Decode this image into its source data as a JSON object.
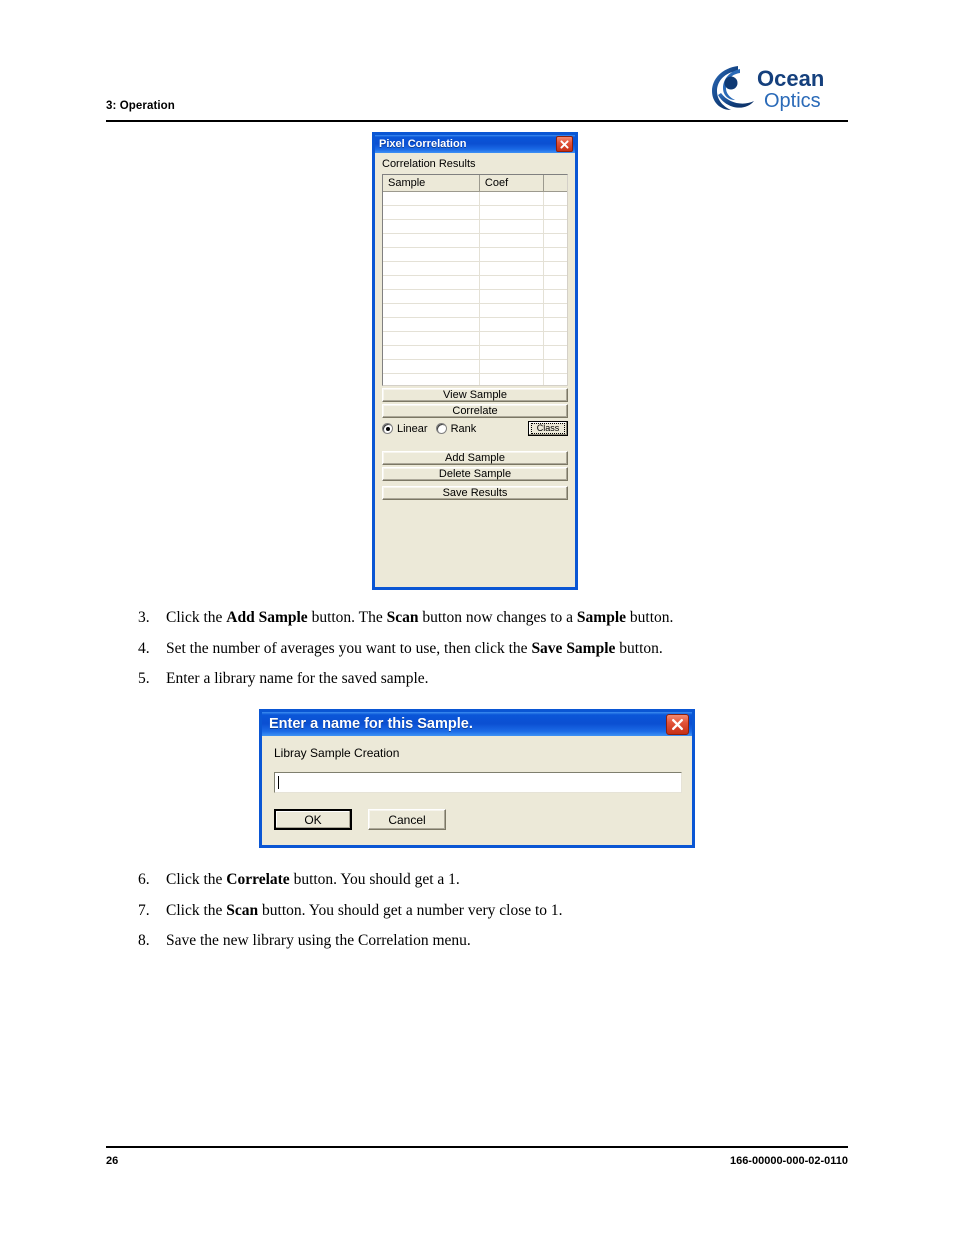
{
  "header": {
    "chapter": "3: Operation",
    "logo": {
      "name": "ocean-optics-logo",
      "line1": "Ocean",
      "line2": "Optics",
      "brand_color": "#1c4f9c"
    }
  },
  "pixel_correlation_dialog": {
    "title": "Pixel Correlation",
    "close_icon": "close-icon",
    "group_label": "Correlation Results",
    "grid": {
      "columns": [
        "Sample",
        "Coef",
        ""
      ],
      "rows": [
        [
          "",
          "",
          ""
        ],
        [
          "",
          "",
          ""
        ],
        [
          "",
          "",
          ""
        ],
        [
          "",
          "",
          ""
        ],
        [
          "",
          "",
          ""
        ],
        [
          "",
          "",
          ""
        ],
        [
          "",
          "",
          ""
        ],
        [
          "",
          "",
          ""
        ],
        [
          "",
          "",
          ""
        ],
        [
          "",
          "",
          ""
        ],
        [
          "",
          "",
          ""
        ],
        [
          "",
          "",
          ""
        ],
        [
          "",
          "",
          ""
        ],
        [
          "",
          "",
          ""
        ]
      ]
    },
    "buttons": {
      "view_sample": "View Sample",
      "correlate": "Correlate",
      "add_sample": "Add Sample",
      "delete_sample": "Delete Sample",
      "save_results": "Save Results",
      "class": "Class"
    },
    "radios": [
      {
        "label": "Linear",
        "checked": true
      },
      {
        "label": "Rank",
        "checked": false
      }
    ]
  },
  "enter_name_dialog": {
    "title": "Enter a name for this Sample.",
    "close_icon": "close-icon",
    "field_label": "Libray Sample Creation",
    "input_value": "",
    "input_placeholder": "",
    "ok_label": "OK",
    "cancel_label": "Cancel"
  },
  "steps_a": [
    {
      "num": "3.",
      "html": "Click the <b>Add Sample</b> button. The <b>Scan</b> button now changes to a <b>Sample</b> button."
    },
    {
      "num": "4.",
      "html": "Set the number of averages you want to use, then click the <b>Save Sample</b> button."
    },
    {
      "num": "5.",
      "html": "Enter a library name for the saved sample."
    }
  ],
  "steps_b": [
    {
      "num": "6.",
      "html": "Click the <b>Correlate</b> button. You should get a 1."
    },
    {
      "num": "7.",
      "html": "Click the <b>Scan</b> button. You should get a number very close to 1."
    },
    {
      "num": "8.",
      "html": "Save the new library using the Correlation menu."
    }
  ],
  "footer": {
    "page_number": "26",
    "document_number": "166-00000-000-02-0110"
  }
}
